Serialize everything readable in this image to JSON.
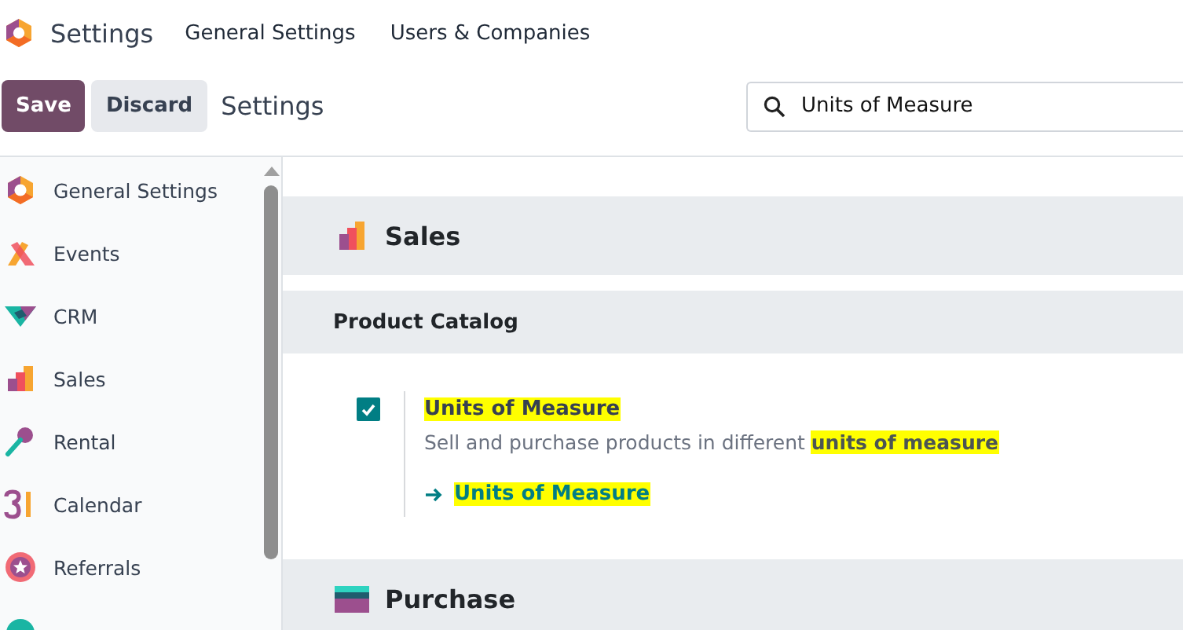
{
  "navbar": {
    "app_title": "Settings",
    "menu": [
      "General Settings",
      "Users & Companies"
    ]
  },
  "control_panel": {
    "buttons": [
      {
        "label": "Save",
        "kind": "primary"
      },
      {
        "label": "Discard",
        "kind": "secondary"
      }
    ],
    "breadcrumb": "Settings",
    "search": {
      "value": "Units of Measure"
    }
  },
  "sidebar": {
    "items": [
      {
        "label": "General Settings",
        "kind": "general"
      },
      {
        "label": "Events",
        "kind": "events"
      },
      {
        "label": "CRM",
        "kind": "crm"
      },
      {
        "label": "Sales",
        "kind": "sales"
      },
      {
        "label": "Rental",
        "kind": "rental"
      },
      {
        "label": "Calendar",
        "kind": "calendar"
      },
      {
        "label": "Referrals",
        "kind": "referrals"
      },
      {
        "kind": "website"
      }
    ]
  },
  "sections": [
    {
      "app": "Sales",
      "kind": "sales",
      "groups": [
        {
          "title": "Product Catalog",
          "settings": [
            {
              "checked": true,
              "title": {
                "text": "Units of Measure",
                "highlighted": true
              },
              "description": [
                {
                  "text": "Sell and purchase products in different ",
                  "highlighted": false
                },
                {
                  "text": "units of measure",
                  "highlighted": true
                }
              ],
              "link": {
                "text": "Units of Measure",
                "highlighted": true
              }
            }
          ]
        }
      ]
    },
    {
      "app": "Purchase",
      "kind": "purchase"
    }
  ]
}
